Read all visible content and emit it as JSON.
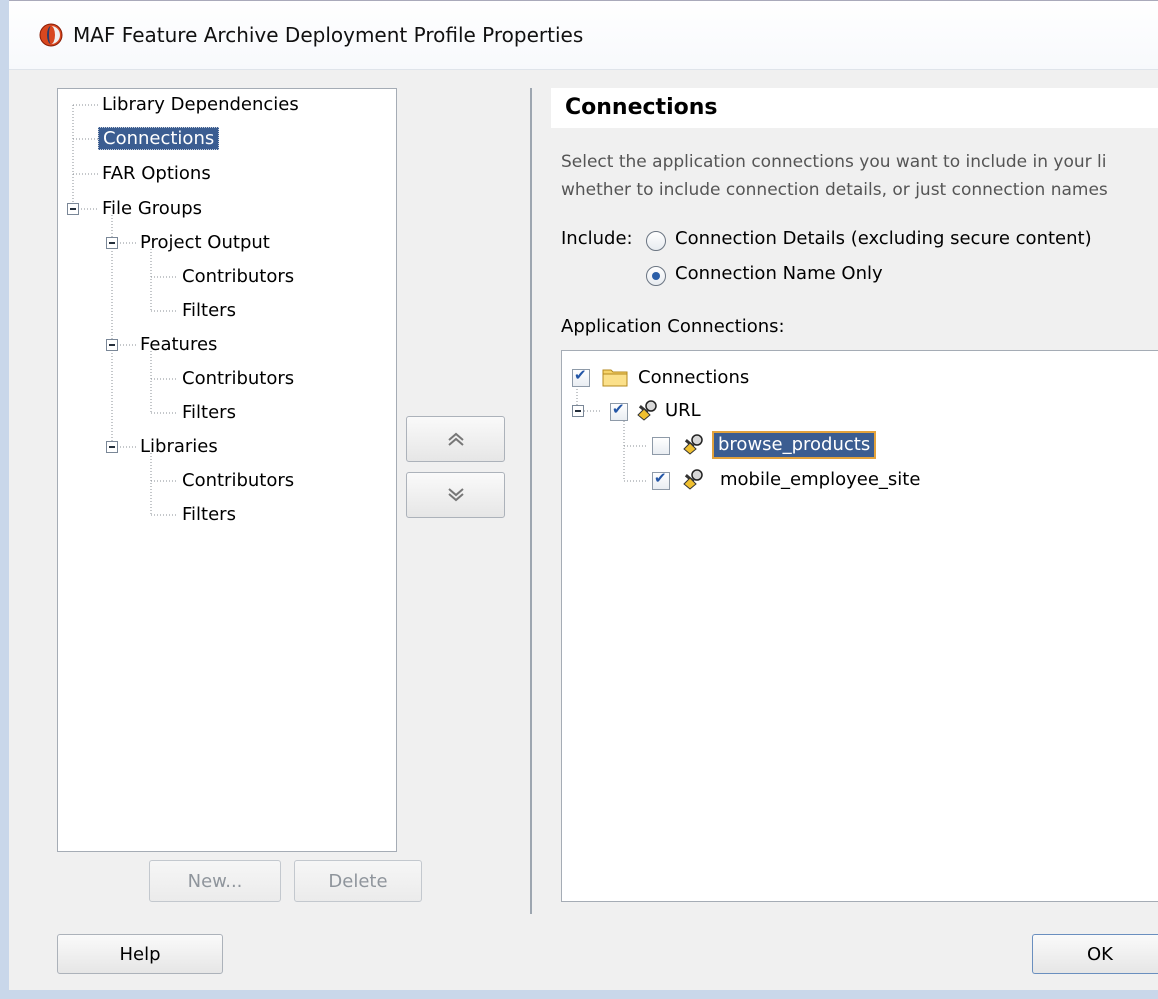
{
  "window": {
    "title": "MAF Feature Archive Deployment Profile Properties"
  },
  "nav_tree": {
    "items": [
      {
        "label": "Library Dependencies"
      },
      {
        "label": "Connections"
      },
      {
        "label": "FAR Options"
      },
      {
        "label": "File Groups"
      },
      {
        "label": "Project Output"
      },
      {
        "label": "Contributors"
      },
      {
        "label": "Filters"
      },
      {
        "label": "Features"
      },
      {
        "label": "Contributors"
      },
      {
        "label": "Filters"
      },
      {
        "label": "Libraries"
      },
      {
        "label": "Contributors"
      },
      {
        "label": "Filters"
      }
    ],
    "selected": "Connections"
  },
  "left_buttons": {
    "new": "New...",
    "delete": "Delete"
  },
  "panel": {
    "title": "Connections",
    "description_line1": "Select the application connections you want to include in your li",
    "description_line2": "whether to include connection details, or just connection names",
    "include_label": "Include:",
    "option_details": "Connection Details (excluding secure content)",
    "option_name_only": "Connection Name Only",
    "selected_option": "Connection Name Only",
    "app_connections_label": "Application Connections:"
  },
  "conn_tree": {
    "root": {
      "label": "Connections",
      "checked": true
    },
    "group": {
      "label": "URL",
      "checked": true
    },
    "items": [
      {
        "label": "browse_products",
        "checked": false,
        "selected": true
      },
      {
        "label": "mobile_employee_site",
        "checked": true,
        "selected": false
      }
    ]
  },
  "footer": {
    "help": "Help",
    "ok": "OK"
  },
  "colors": {
    "selection": "#3b5d91",
    "focus_border": "#e2a23c",
    "check": "#2456a6"
  }
}
